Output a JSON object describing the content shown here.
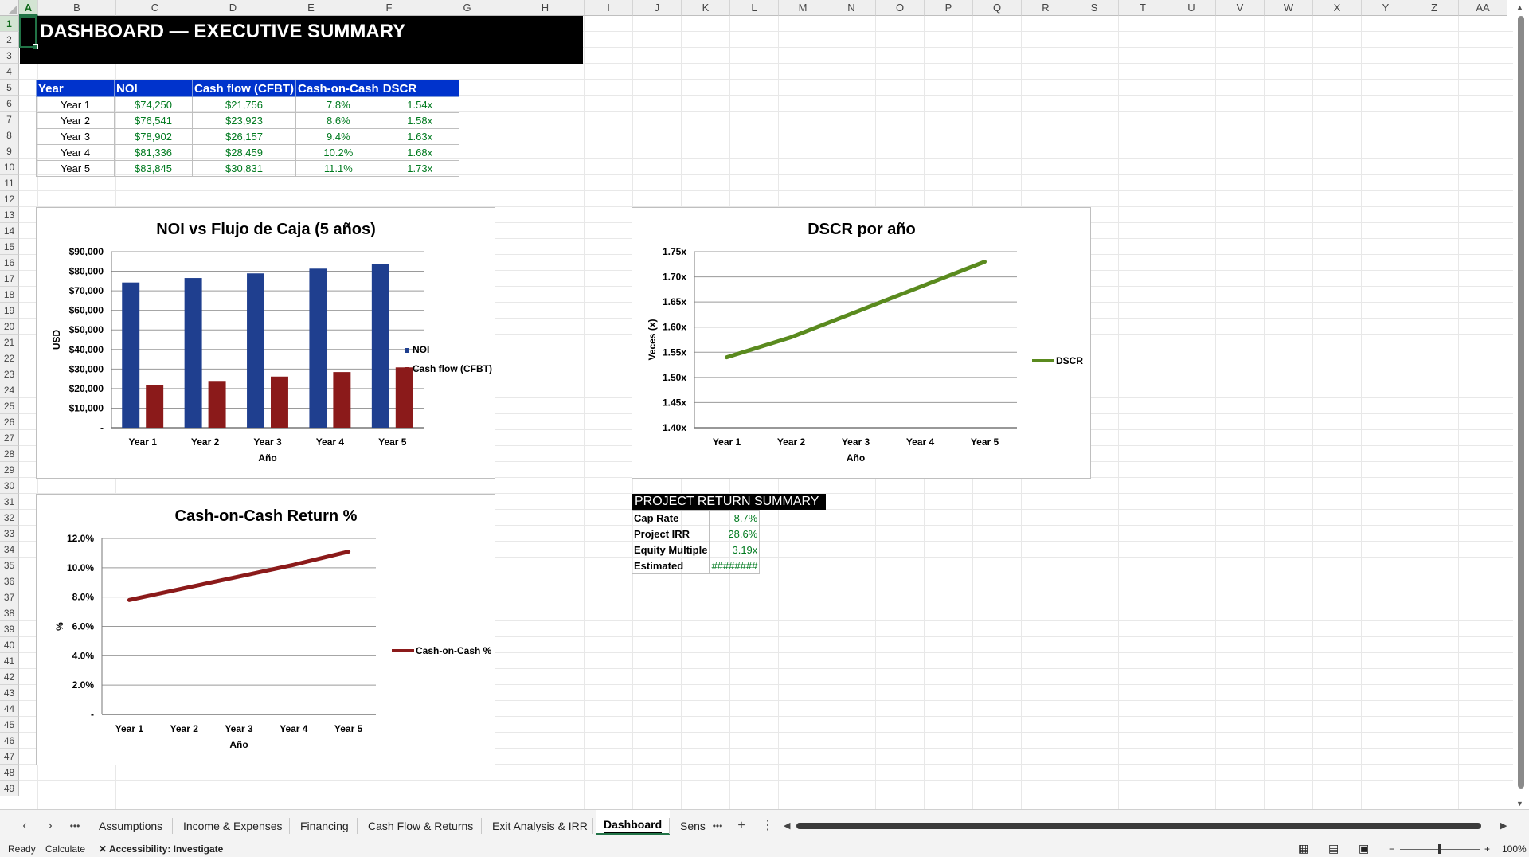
{
  "columns": [
    "A",
    "B",
    "C",
    "D",
    "E",
    "F",
    "G",
    "H",
    "I",
    "J",
    "K",
    "L",
    "M",
    "N",
    "O",
    "P",
    "Q",
    "R",
    "S",
    "T",
    "U",
    "V",
    "W",
    "X",
    "Y",
    "Z",
    "AA"
  ],
  "rows": [
    "1",
    "2",
    "3",
    "4",
    "5",
    "6",
    "7",
    "8",
    "9",
    "10",
    "11",
    "12",
    "13",
    "14",
    "15",
    "16",
    "17",
    "18",
    "19",
    "20",
    "21",
    "22",
    "23",
    "24",
    "25",
    "26",
    "27",
    "28",
    "29",
    "30",
    "31",
    "32",
    "33",
    "34",
    "35",
    "36",
    "37",
    "38",
    "39",
    "40",
    "41",
    "42",
    "43",
    "44",
    "45",
    "46",
    "47",
    "48",
    "49"
  ],
  "title": "DASHBOARD — EXECUTIVE SUMMARY",
  "summary_table": {
    "headers": [
      "Year",
      "NOI",
      "Cash flow (CFBT)",
      "Cash-on-Cash",
      "DSCR"
    ],
    "rows": [
      [
        "Year 1",
        "$74,250",
        "$21,756",
        "7.8%",
        "1.54x"
      ],
      [
        "Year 2",
        "$76,541",
        "$23,923",
        "8.6%",
        "1.58x"
      ],
      [
        "Year 3",
        "$78,902",
        "$26,157",
        "9.4%",
        "1.63x"
      ],
      [
        "Year 4",
        "$81,336",
        "$28,459",
        "10.2%",
        "1.68x"
      ],
      [
        "Year 5",
        "$83,845",
        "$30,831",
        "11.1%",
        "1.73x"
      ]
    ]
  },
  "chart_data": [
    {
      "type": "bar",
      "title": "NOI vs Flujo de Caja (5 años)",
      "xlabel": "Año",
      "ylabel": "USD",
      "categories": [
        "Year 1",
        "Year 2",
        "Year 3",
        "Year 4",
        "Year 5"
      ],
      "series": [
        {
          "name": "NOI",
          "values": [
            74250,
            76541,
            78902,
            81336,
            83845
          ],
          "color": "#1f3f8f"
        },
        {
          "name": "Cash flow (CFBT)",
          "values": [
            21756,
            23923,
            26157,
            28459,
            30831
          ],
          "color": "#8b1a1a"
        }
      ],
      "ylim": [
        0,
        90000
      ],
      "yticks": [
        "-",
        "$10,000",
        "$20,000",
        "$30,000",
        "$40,000",
        "$50,000",
        "$60,000",
        "$70,000",
        "$80,000",
        "$90,000"
      ],
      "legend": "right",
      "grid": true
    },
    {
      "type": "line",
      "title": "DSCR por año",
      "xlabel": "Año",
      "ylabel": "Veces (x)",
      "categories": [
        "Year 1",
        "Year 2",
        "Year 3",
        "Year 4",
        "Year 5"
      ],
      "series": [
        {
          "name": "DSCR",
          "values": [
            1.54,
            1.58,
            1.63,
            1.68,
            1.73
          ],
          "color": "#5a8a1e"
        }
      ],
      "ylim": [
        1.4,
        1.75
      ],
      "yticks": [
        "1.40x",
        "1.45x",
        "1.50x",
        "1.55x",
        "1.60x",
        "1.65x",
        "1.70x",
        "1.75x"
      ],
      "legend": "right",
      "grid": true
    },
    {
      "type": "line",
      "title": "Cash-on-Cash Return %",
      "xlabel": "Año",
      "ylabel": "%",
      "categories": [
        "Year 1",
        "Year 2",
        "Year 3",
        "Year 4",
        "Year 5"
      ],
      "series": [
        {
          "name": "Cash-on-Cash %",
          "values": [
            7.8,
            8.6,
            9.4,
            10.2,
            11.1
          ],
          "color": "#8b1a1a"
        }
      ],
      "ylim": [
        0,
        12
      ],
      "yticks": [
        "-",
        "2.0%",
        "4.0%",
        "6.0%",
        "8.0%",
        "10.0%",
        "12.0%"
      ],
      "legend": "right",
      "grid": true
    }
  ],
  "project_summary": {
    "title": "PROJECT RETURN SUMMARY",
    "rows": [
      {
        "label": "Cap Rate",
        "value": "8.7%"
      },
      {
        "label": "Project IRR",
        "value": "28.6%"
      },
      {
        "label": "Equity Multiple",
        "value": "3.19x"
      },
      {
        "label": "Estimated",
        "value": "########"
      }
    ]
  },
  "tabs": {
    "items": [
      "Assumptions",
      "Income & Expenses",
      "Financing",
      "Cash Flow & Returns",
      "Exit Analysis & IRR",
      "Dashboard",
      "Sens"
    ],
    "active": "Dashboard",
    "more": "•••",
    "add": "+",
    "menu": "⋮",
    "prev": "‹",
    "next": "›"
  },
  "status": {
    "ready": "Ready",
    "calculate": "Calculate",
    "accessibility": "Accessibility: Investigate",
    "zoom": "100%",
    "zoom_minus": "−",
    "zoom_plus": "+"
  },
  "colors": {
    "excel_green": "#217346",
    "header_blue": "#0033cc",
    "value_green": "#007a1f"
  }
}
